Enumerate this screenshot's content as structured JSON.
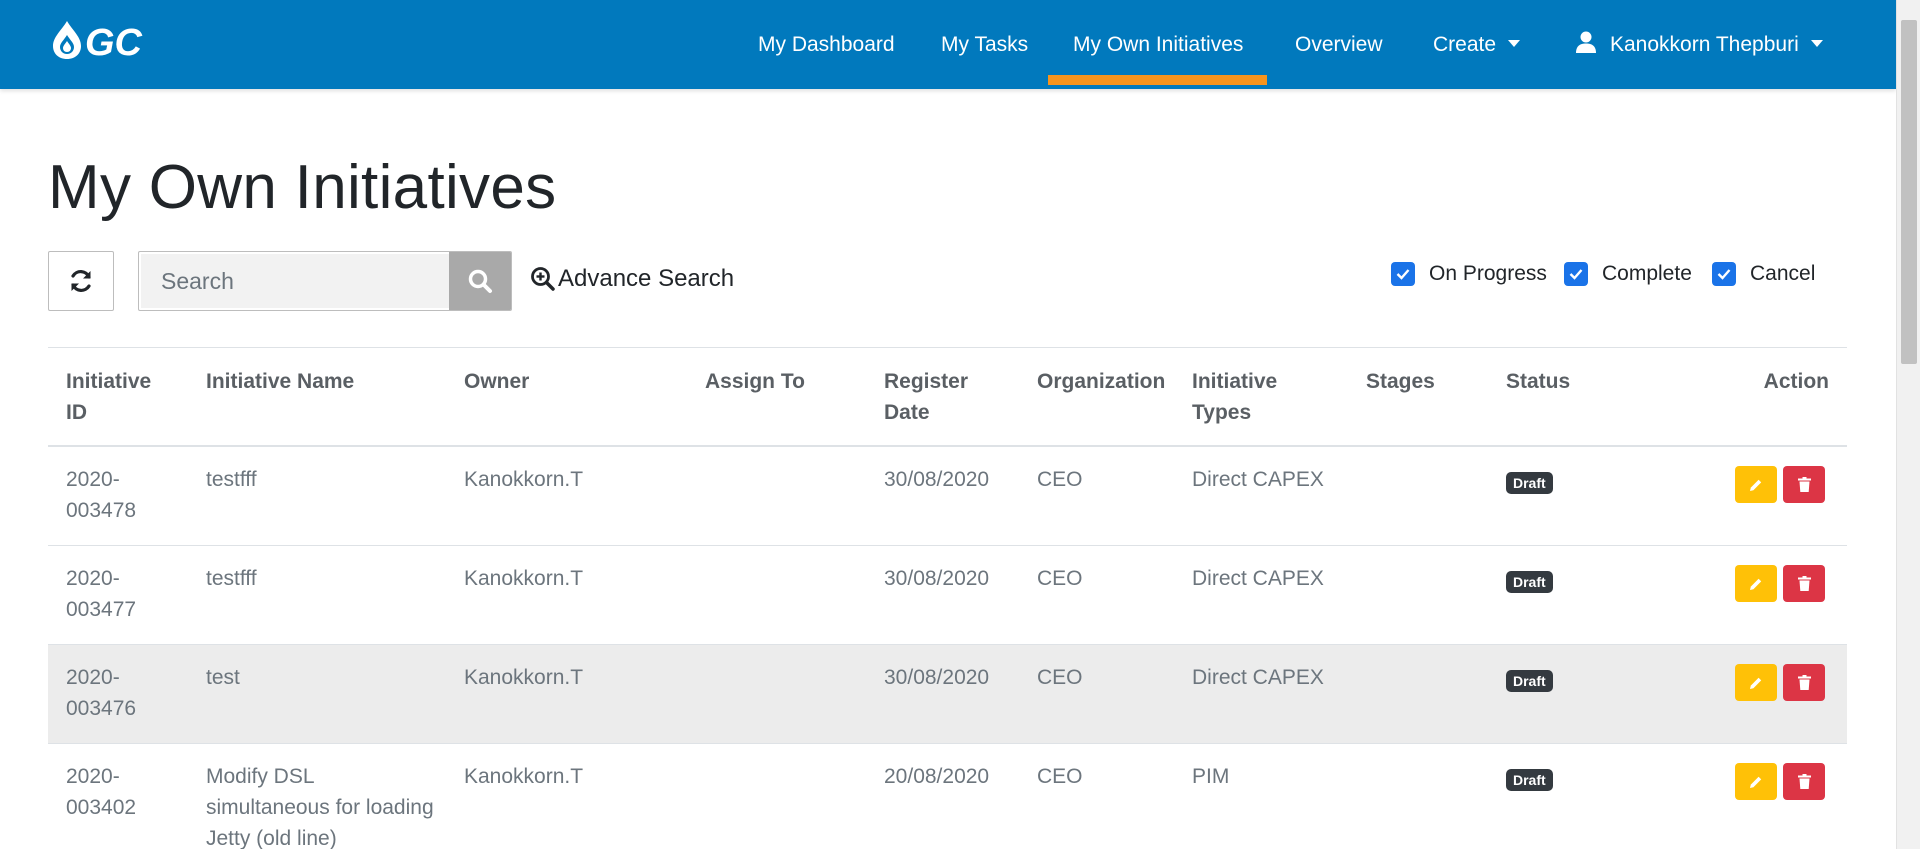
{
  "brand": {
    "logo_text": "GC"
  },
  "nav": {
    "items": [
      {
        "label": "My Dashboard"
      },
      {
        "label": "My Tasks"
      },
      {
        "label": "My Own Initiatives",
        "active": true
      },
      {
        "label": "Overview"
      },
      {
        "label": "Create"
      }
    ],
    "user": "Kanokkorn Thepburi"
  },
  "page": {
    "title": "My Own Initiatives"
  },
  "toolbar": {
    "search_placeholder": "Search",
    "advance_search": "Advance Search",
    "filters": [
      {
        "label": "On Progress",
        "checked": true
      },
      {
        "label": "Complete",
        "checked": true
      },
      {
        "label": "Cancel",
        "checked": true
      }
    ]
  },
  "table": {
    "headers": {
      "id": "Initiative ID",
      "name": "Initiative Name",
      "owner": "Owner",
      "assign": "Assign To",
      "date": "Register Date",
      "org": "Organization",
      "types": "Initiative Types",
      "stages": "Stages",
      "status": "Status",
      "action": "Action"
    },
    "rows": [
      {
        "id": "2020-003478",
        "name": "testfff",
        "owner": "Kanokkorn.T",
        "assign": "",
        "date": "30/08/2020",
        "org": "CEO",
        "types": "Direct CAPEX",
        "stages": "",
        "status": "Draft"
      },
      {
        "id": "2020-003477",
        "name": "testfff",
        "owner": "Kanokkorn.T",
        "assign": "",
        "date": "30/08/2020",
        "org": "CEO",
        "types": "Direct CAPEX",
        "stages": "",
        "status": "Draft"
      },
      {
        "id": "2020-003476",
        "name": "test",
        "owner": "Kanokkorn.T",
        "assign": "",
        "date": "30/08/2020",
        "org": "CEO",
        "types": "Direct CAPEX",
        "stages": "",
        "status": "Draft"
      },
      {
        "id": "2020-003402",
        "name": "Modify DSL simultaneous for loading Jetty (old line)",
        "owner": "Kanokkorn.T",
        "assign": "",
        "date": "20/08/2020",
        "org": "CEO",
        "types": "PIM",
        "stages": "",
        "status": "Draft"
      }
    ]
  },
  "colors": {
    "navbar": "#0179bd",
    "active_underline": "#f7941d",
    "edit_button": "#ffc107",
    "delete_button": "#dc3545",
    "checkbox": "#1a73e8",
    "badge": "#343a40"
  }
}
